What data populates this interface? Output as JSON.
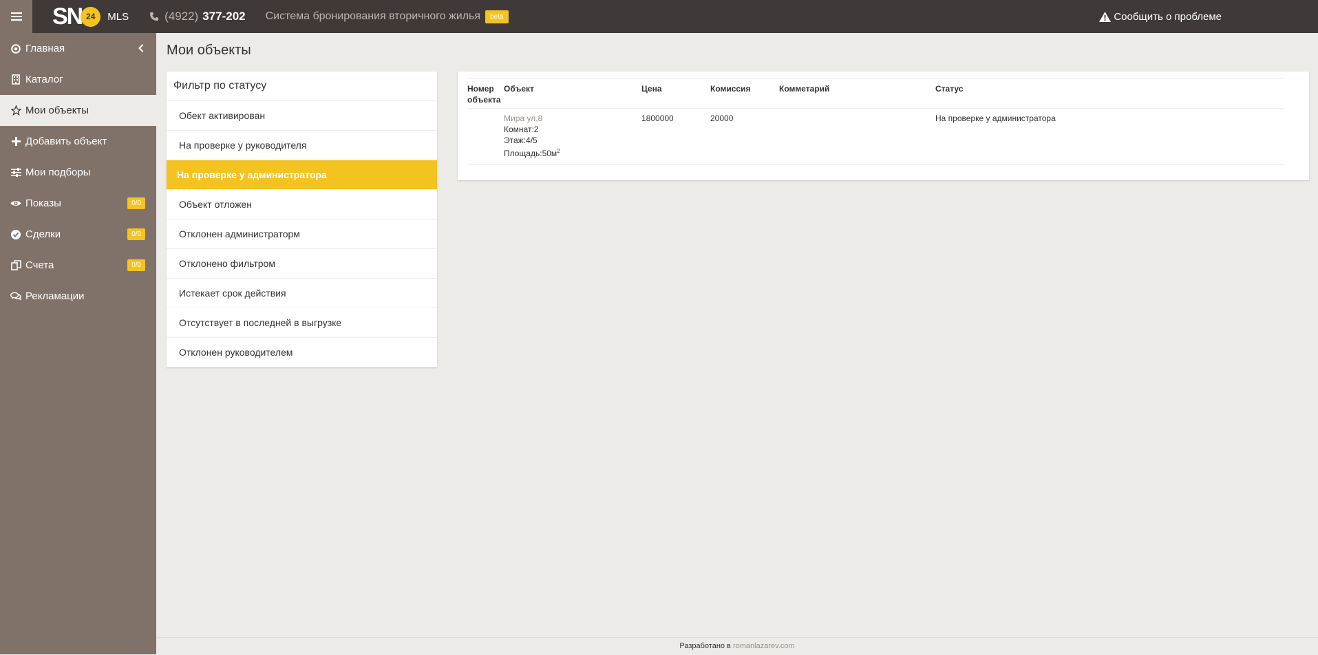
{
  "header": {
    "logo_text": "SN",
    "logo_badge": "24",
    "mls": "MLS",
    "phone_code": "(4922)",
    "phone_number": "377-202",
    "system_title": "Система бронирования вторичного жилья",
    "beta": "beta",
    "report_label": "Сообщить о проблеме"
  },
  "sidebar": {
    "items": [
      {
        "label": "Главная",
        "icon": "circle-dot-icon"
      },
      {
        "label": "Каталог",
        "icon": "building-icon"
      },
      {
        "label": "Мои объекты",
        "icon": "star-icon"
      },
      {
        "label": "Добавить объект",
        "icon": "plus-icon"
      },
      {
        "label": "Мои подборы",
        "icon": "sliders-icon"
      },
      {
        "label": "Показы",
        "icon": "eye-icon",
        "badge": "0/0"
      },
      {
        "label": "Сделки",
        "icon": "check-circle-icon",
        "badge": "0/0"
      },
      {
        "label": "Счета",
        "icon": "copy-icon",
        "badge": "0/0"
      },
      {
        "label": "Рекламации",
        "icon": "comments-icon"
      }
    ]
  },
  "main": {
    "page_title": "Мои объекты",
    "filter": {
      "title": "Фильтр по статусу",
      "items": [
        "Обект активирован",
        "На проверке у руководителя",
        "На проверке у администратора",
        "Объект отложен",
        "Отклонен администраторм",
        "Отклонено фильтром",
        "Истекает срок действия",
        "Отсутствует в последней в выгрузке",
        "Отклонен руководителем"
      ],
      "active": "На проверке у администратора"
    },
    "table": {
      "headers": {
        "number_line1": "Номер",
        "number_line2": "объекта",
        "object": "Объект",
        "price": "Цена",
        "commission": "Комиссия",
        "comment": "Комметарий",
        "status": "Статус"
      },
      "rows": [
        {
          "number": "",
          "address": "Мира ул,8",
          "rooms": "Комнат:2",
          "floor": "Этаж:4/5",
          "area": "Площадь:50м",
          "area_sup": "2",
          "price": "1800000",
          "commission": "20000",
          "comment": "",
          "status": "На проверке у администратора"
        }
      ]
    }
  },
  "footer": {
    "text": "Разработано в",
    "link": "romanlazarev.com"
  },
  "colors": {
    "topbar": "#3f3a37",
    "sidebar": "#817269",
    "accent": "#f5c320",
    "background": "#ecebe7"
  }
}
